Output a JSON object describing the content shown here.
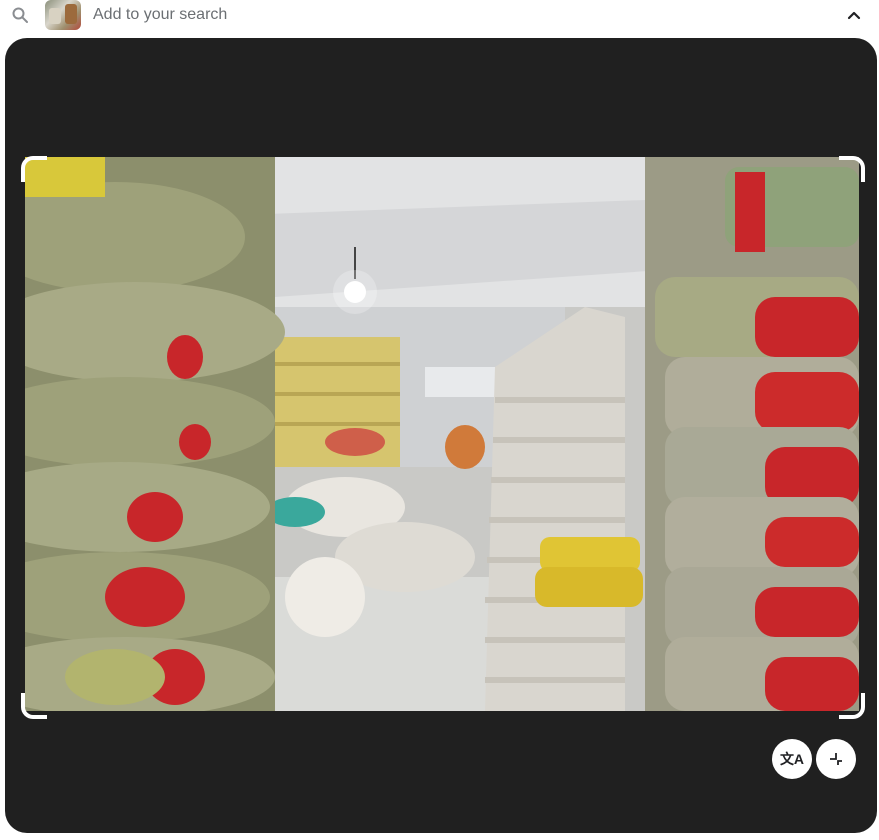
{
  "search_bar": {
    "placeholder": "Add to your search",
    "search_icon": "search-icon",
    "thumbnail_icon": "image-thumbnail",
    "collapse_icon": "chevron-up-icon"
  },
  "viewer": {
    "image_subject": "warehouse-sacks-photo",
    "translate_button": {
      "icon": "translate-icon",
      "glyph": "文A"
    },
    "collapse_button": {
      "icon": "exit-fullscreen-icon"
    }
  },
  "colors": {
    "panel_bg": "#202020",
    "page_bg": "#ffffff",
    "placeholder_text": "#6b6f73"
  }
}
